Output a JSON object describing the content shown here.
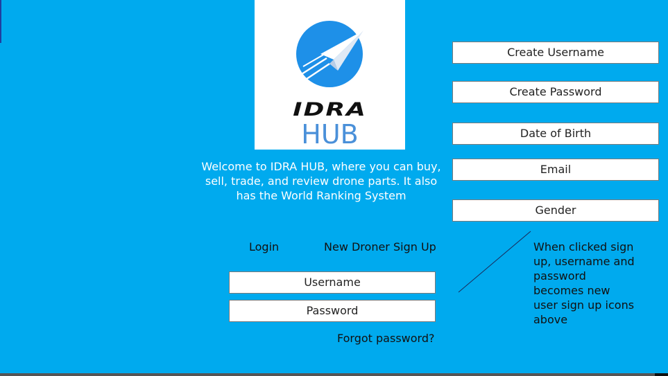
{
  "logo": {
    "wordmark": "IDRA",
    "sub": "HUB"
  },
  "welcome_text": "Welcome to IDRA HUB, where you can buy, sell, trade, and review drone parts. It also has the World Ranking System",
  "tabs": {
    "login": "Login",
    "signup": "New Droner Sign Up"
  },
  "login_form": {
    "username": "Username",
    "password": "Password",
    "forgot": "Forgot password?"
  },
  "signup_form": {
    "create_username": "Create Username",
    "create_password": "Create Password",
    "date_of_birth": "Date of Birth",
    "email": "Email",
    "gender": "Gender"
  },
  "annotation": "When clicked sign up, username and password becomes new user sign up icons above",
  "colors": {
    "background": "#00aaee",
    "logo_circle": "#1e90e8",
    "hub_text": "#4a90d9"
  },
  "icons": [
    "paper-plane-icon"
  ]
}
